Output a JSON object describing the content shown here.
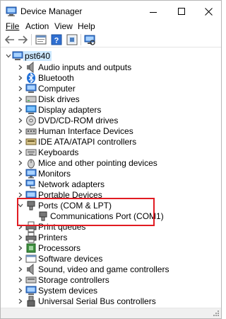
{
  "window": {
    "title": "Device Manager"
  },
  "menu": {
    "file": "File",
    "action": "Action",
    "view": "View",
    "help": "Help"
  },
  "toolbar": {
    "buttons": [
      "back-icon",
      "forward-icon",
      "properties-icon",
      "help-icon",
      "scan-hardware-icon"
    ]
  },
  "tree": {
    "root": "pst640",
    "categories": [
      "Audio inputs and outputs",
      "Bluetooth",
      "Computer",
      "Disk drives",
      "Display adapters",
      "DVD/CD-ROM drives",
      "Human Interface Devices",
      "IDE ATA/ATAPI controllers",
      "Keyboards",
      "Mice and other pointing devices",
      "Monitors",
      "Network adapters",
      "Portable Devices",
      "Ports (COM & LPT)",
      "Communications Port (COM1)",
      "Print queues",
      "Printers",
      "Processors",
      "Software devices",
      "Sound, video and game controllers",
      "Storage controllers",
      "System devices",
      "Universal Serial Bus controllers"
    ]
  },
  "colors": {
    "selection": "#cce8ff",
    "highlight_border": "#e11b22"
  }
}
